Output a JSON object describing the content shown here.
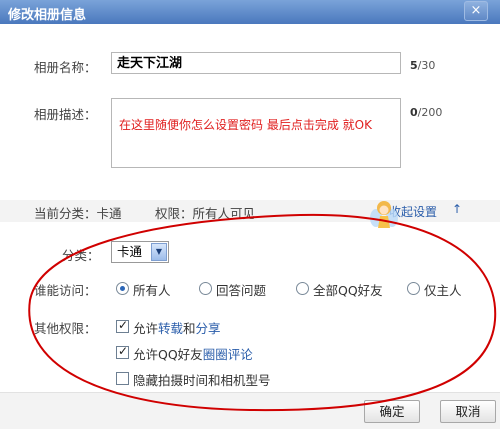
{
  "dialog": {
    "title": "修改相册信息",
    "close_glyph": "×"
  },
  "form": {
    "name_label": "相册名称：",
    "name_value": "走天下江湖",
    "name_counter_used": "5",
    "name_counter_max": "/30",
    "desc_label": "相册描述：",
    "desc_overlay": "在这里随便你怎么设置密码 最后点击完成 就OK",
    "desc_counter_used": "0",
    "desc_counter_max": "/200"
  },
  "info": {
    "category": "当前分类：卡通",
    "permission": "权限：所有人可见",
    "collapse_link": "收起设置",
    "collapse_arrow": "↑"
  },
  "settings": {
    "category_label": "分类：",
    "category_selected": "卡通",
    "access_label": "谁能访问：",
    "access_options": [
      {
        "label": "所有人",
        "selected": true
      },
      {
        "label": "回答问题",
        "selected": false
      },
      {
        "label": "全部QQ好友",
        "selected": false
      },
      {
        "label": "仅主人",
        "selected": false
      }
    ],
    "other_label": "其他权限：",
    "perms": [
      {
        "parts": [
          "允许",
          "转载",
          "和",
          "分享"
        ],
        "checked": true
      },
      {
        "parts": [
          "允许QQ好友",
          "圈圈评论"
        ],
        "checked": true
      },
      {
        "parts": [
          "隐藏拍摄时间和相机型号"
        ],
        "checked": false
      }
    ]
  },
  "footer": {
    "ok": "确定",
    "cancel": "取消"
  },
  "colors": {
    "title_bar": "#5a86c8",
    "annotation_red": "#e02020",
    "link_blue": "#2a5daa"
  }
}
